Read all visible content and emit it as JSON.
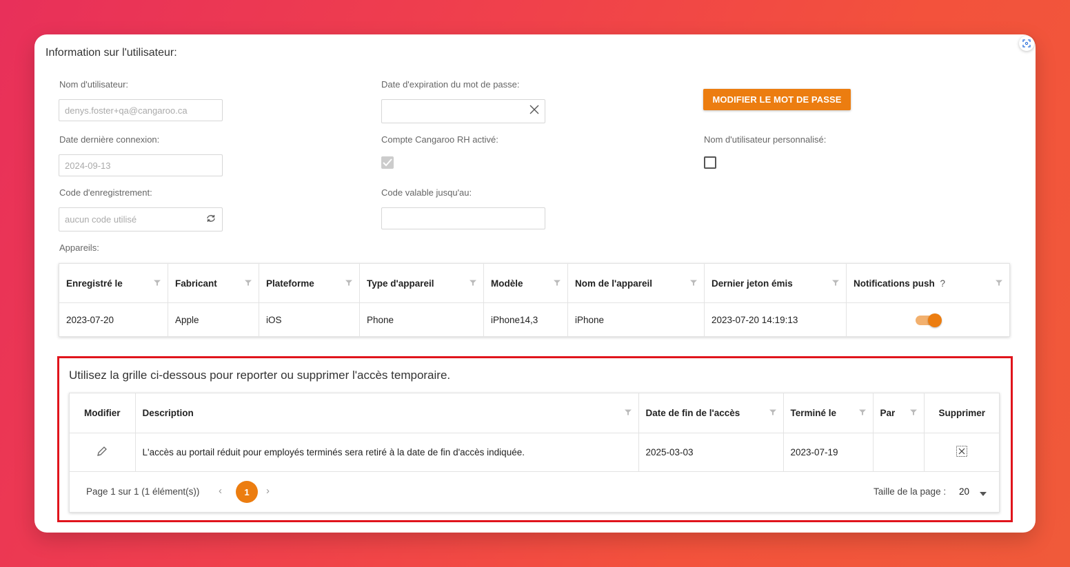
{
  "section": {
    "title": "Information sur l'utilisateur:"
  },
  "fields": {
    "username_label": "Nom d'utilisateur:",
    "username_value": "denys.foster+qa@cangaroo.ca",
    "pwd_exp_label": "Date d'expiration du mot de passe:",
    "pwd_exp_value": "",
    "change_pwd_button": "MODIFIER LE MOT DE PASSE",
    "last_login_label": "Date dernière connexion:",
    "last_login_value": "2024-09-13",
    "hr_account_label": "Compte Cangaroo RH activé:",
    "hr_account_checked": true,
    "custom_username_label": "Nom d'utilisateur personnalisé:",
    "custom_username_checked": false,
    "reg_code_label": "Code d'enregistrement:",
    "reg_code_value": "aucun code utilisé",
    "code_valid_label": "Code valable jusqu'au:",
    "code_valid_value": "",
    "devices_label": "Appareils:"
  },
  "devices": {
    "columns": [
      "Enregistré le",
      "Fabricant",
      "Plateforme",
      "Type d'appareil",
      "Modèle",
      "Nom de l'appareil",
      "Dernier jeton émis",
      "Notifications push"
    ],
    "help_mark": "?",
    "rows": [
      {
        "registered": "2023-07-20",
        "manufacturer": "Apple",
        "platform": "iOS",
        "type": "Phone",
        "model": "iPhone14,3",
        "name": "iPhone",
        "last_token": "2023-07-20 14:19:13",
        "push_enabled": true
      }
    ]
  },
  "temp_access": {
    "title": "Utilisez la grille ci-dessous pour reporter ou supprimer l'accès temporaire.",
    "columns": [
      "Modifier",
      "Description",
      "Date de fin de l'accès",
      "Terminé le",
      "Par",
      "Supprimer"
    ],
    "rows": [
      {
        "description": "L'accès au portail réduit pour employés terminés sera retiré à la date de fin d'accès indiquée.",
        "end_date": "2025-03-03",
        "terminated": "2023-07-19",
        "by": ""
      }
    ],
    "pager": {
      "info": "Page 1 sur 1 (1 élément(s))",
      "current_page": "1",
      "page_size_label": "Taille de la page :",
      "page_size": "20"
    }
  },
  "colors": {
    "accent": "#ec7d10",
    "highlight_border": "#e0141c"
  }
}
